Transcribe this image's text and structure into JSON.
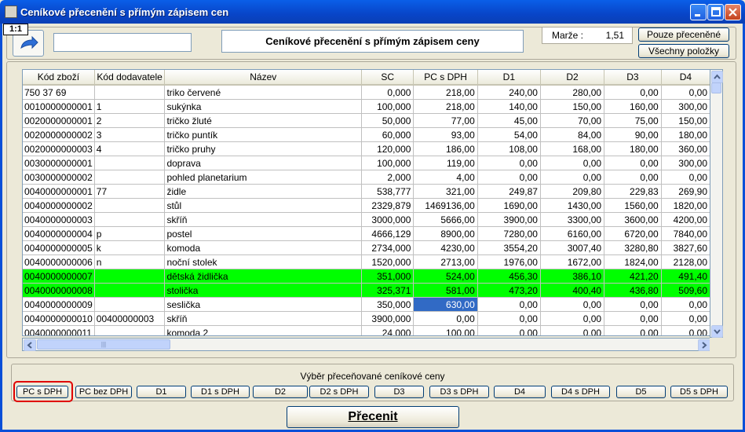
{
  "window": {
    "title": "Ceníkové přecenění s přímým zápisem cen"
  },
  "header": {
    "record_counter": "1:1",
    "search_value": "",
    "caption": "Ceníkové přecenění s přímým zápisem ceny",
    "marze_label": "Marže :",
    "marze_value": "1,51",
    "only_repriced_label": "Pouze přeceněné",
    "all_items_label": "Všechny položky"
  },
  "table": {
    "columns": [
      "Kód zboží",
      "Kód dodavatele",
      "Název",
      "SC",
      "PC s DPH",
      "D1",
      "D2",
      "D3",
      "D4"
    ],
    "rows": [
      {
        "kod": "750 37 69",
        "dod": "",
        "nazev": "triko červené",
        "sc": "0,000",
        "pc": "218,00",
        "d1": "240,00",
        "d2": "280,00",
        "d3": "0,00",
        "d4": "0,00"
      },
      {
        "kod": "0010000000001",
        "dod": "1",
        "nazev": "sukýnka",
        "sc": "100,000",
        "pc": "218,00",
        "d1": "140,00",
        "d2": "150,00",
        "d3": "160,00",
        "d4": "300,00"
      },
      {
        "kod": "0020000000001",
        "dod": "2",
        "nazev": "tričko žluté",
        "sc": "50,000",
        "pc": "77,00",
        "d1": "45,00",
        "d2": "70,00",
        "d3": "75,00",
        "d4": "150,00"
      },
      {
        "kod": "0020000000002",
        "dod": "3",
        "nazev": "tričko puntík",
        "sc": "60,000",
        "pc": "93,00",
        "d1": "54,00",
        "d2": "84,00",
        "d3": "90,00",
        "d4": "180,00"
      },
      {
        "kod": "0020000000003",
        "dod": "4",
        "nazev": "tričko pruhy",
        "sc": "120,000",
        "pc": "186,00",
        "d1": "108,00",
        "d2": "168,00",
        "d3": "180,00",
        "d4": "360,00"
      },
      {
        "kod": "0030000000001",
        "dod": "",
        "nazev": "doprava",
        "sc": "100,000",
        "pc": "119,00",
        "d1": "0,00",
        "d2": "0,00",
        "d3": "0,00",
        "d4": "300,00"
      },
      {
        "kod": "0030000000002",
        "dod": "",
        "nazev": "pohled planetarium",
        "sc": "2,000",
        "pc": "4,00",
        "d1": "0,00",
        "d2": "0,00",
        "d3": "0,00",
        "d4": "0,00"
      },
      {
        "kod": "0040000000001",
        "dod": "77",
        "nazev": "židle",
        "sc": "538,777",
        "pc": "321,00",
        "d1": "249,87",
        "d2": "209,80",
        "d3": "229,83",
        "d4": "269,90"
      },
      {
        "kod": "0040000000002",
        "dod": "",
        "nazev": "stůl",
        "sc": "2329,879",
        "pc": "1469136,00",
        "d1": "1690,00",
        "d2": "1430,00",
        "d3": "1560,00",
        "d4": "1820,00"
      },
      {
        "kod": "0040000000003",
        "dod": "",
        "nazev": "skříň",
        "sc": "3000,000",
        "pc": "5666,00",
        "d1": "3900,00",
        "d2": "3300,00",
        "d3": "3600,00",
        "d4": "4200,00"
      },
      {
        "kod": "0040000000004",
        "dod": "p",
        "nazev": "postel",
        "sc": "4666,129",
        "pc": "8900,00",
        "d1": "7280,00",
        "d2": "6160,00",
        "d3": "6720,00",
        "d4": "7840,00"
      },
      {
        "kod": "0040000000005",
        "dod": "k",
        "nazev": "komoda",
        "sc": "2734,000",
        "pc": "4230,00",
        "d1": "3554,20",
        "d2": "3007,40",
        "d3": "3280,80",
        "d4": "3827,60"
      },
      {
        "kod": "0040000000006",
        "dod": "n",
        "nazev": "noční stolek",
        "sc": "1520,000",
        "pc": "2713,00",
        "d1": "1976,00",
        "d2": "1672,00",
        "d3": "1824,00",
        "d4": "2128,00"
      },
      {
        "kod": "0040000000007",
        "dod": "",
        "nazev": "dětská židlička",
        "sc": "351,000",
        "pc": "524,00",
        "d1": "456,30",
        "d2": "386,10",
        "d3": "421,20",
        "d4": "491,40",
        "highlight": true
      },
      {
        "kod": "0040000000008",
        "dod": "",
        "nazev": "stolička",
        "sc": "325,371",
        "pc": "581,00",
        "d1": "473,20",
        "d2": "400,40",
        "d3": "436,80",
        "d4": "509,60",
        "highlight": true
      },
      {
        "kod": "0040000000009",
        "dod": "",
        "nazev": "seslička",
        "sc": "350,000",
        "pc": "630,00",
        "d1": "0,00",
        "d2": "0,00",
        "d3": "0,00",
        "d4": "0,00",
        "selected_col": "pc"
      },
      {
        "kod": "0040000000010",
        "dod": "00400000003",
        "nazev": "skříň",
        "sc": "3900,000",
        "pc": "0,00",
        "d1": "0,00",
        "d2": "0,00",
        "d3": "0,00",
        "d4": "0,00"
      },
      {
        "kod": "0040000000011",
        "dod": "",
        "nazev": "komoda 2",
        "sc": "24,000",
        "pc": "100,00",
        "d1": "0,00",
        "d2": "0,00",
        "d3": "0,00",
        "d4": "0,00"
      }
    ]
  },
  "price_selector": {
    "title": "Výběr přeceňované ceníkové ceny",
    "selected": "PC s DPH",
    "options": [
      "PC s DPH",
      "PC bez DPH",
      "D1",
      "D1 s DPH",
      "D2",
      "D2 s DPH",
      "D3",
      "D3 s DPH",
      "D4",
      "D4 s DPH",
      "D5",
      "D5 s DPH"
    ]
  },
  "actions": {
    "reprice_label": "Přecenit"
  },
  "colors": {
    "titlebar": "#0845c8",
    "highlight_row": "#00ff00",
    "selected_cell": "#316ac5",
    "selected_ring": "#e00000"
  }
}
